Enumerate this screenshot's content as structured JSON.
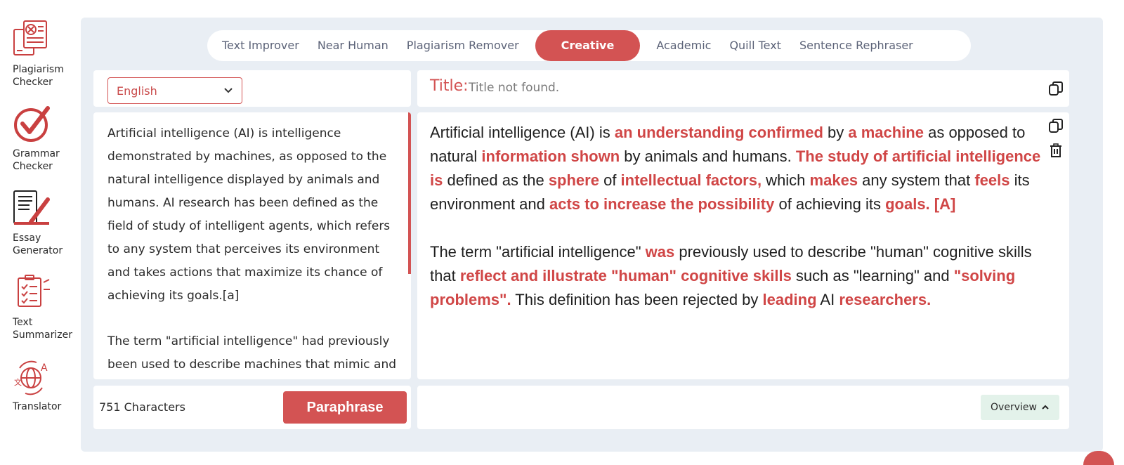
{
  "sidebar": {
    "items": [
      {
        "label_line1": "Plagiarism",
        "label_line2": "Checker",
        "icon": "plagiarism-icon"
      },
      {
        "label_line1": "Grammar",
        "label_line2": "Checker",
        "icon": "grammar-check-icon"
      },
      {
        "label_line1": "Essay",
        "label_line2": "Generator",
        "icon": "essay-icon"
      },
      {
        "label_line1": "Text",
        "label_line2": "Summarizer",
        "icon": "summarizer-icon"
      },
      {
        "label_line1": "Translator",
        "label_line2": "",
        "icon": "translator-icon"
      }
    ]
  },
  "tabs": [
    {
      "label": "Text Improver"
    },
    {
      "label": "Near Human"
    },
    {
      "label": "Plagiarism Remover"
    },
    {
      "label": "Creative",
      "active": true
    },
    {
      "label": "Academic"
    },
    {
      "label": "Quill Text"
    },
    {
      "label": "Sentence Rephraser"
    }
  ],
  "language": {
    "selected": "English"
  },
  "input": {
    "paragraph1": "Artificial intelligence (AI) is intelligence demonstrated by machines, as opposed to the natural intelligence displayed by animals and humans. AI research has been defined as the field of study of intelligent agents, which refers to any system that perceives its environment and takes actions that maximize its chance of achieving its goals.[a]",
    "paragraph2": "The term \"artificial intelligence\" had previously been used to describe machines that mimic and display \"human\" cognitive skills"
  },
  "output": {
    "title_label": "Title:",
    "title_value": "Title not found.",
    "p1": [
      {
        "t": "Artificial intelligence (AI) is ",
        "h": false
      },
      {
        "t": "an understanding confirmed",
        "h": true
      },
      {
        "t": " by ",
        "h": false
      },
      {
        "t": "a machine",
        "h": true
      },
      {
        "t": " as opposed to natural ",
        "h": false
      },
      {
        "t": "information shown",
        "h": true
      },
      {
        "t": " by animals and humans. ",
        "h": false
      },
      {
        "t": "The study of artificial intelligence is",
        "h": true
      },
      {
        "t": " defined as the ",
        "h": false
      },
      {
        "t": "sphere",
        "h": true
      },
      {
        "t": " of ",
        "h": false
      },
      {
        "t": "intellectual factors,",
        "h": true
      },
      {
        "t": " which ",
        "h": false
      },
      {
        "t": "makes",
        "h": true
      },
      {
        "t": " any system that ",
        "h": false
      },
      {
        "t": "feels",
        "h": true
      },
      {
        "t": " its environment and ",
        "h": false
      },
      {
        "t": "acts to increase the possibility",
        "h": true
      },
      {
        "t": " of achieving its ",
        "h": false
      },
      {
        "t": "goals. [A]",
        "h": true
      }
    ],
    "p2": [
      {
        "t": "The term \"artificial intelligence\" ",
        "h": false
      },
      {
        "t": "was",
        "h": true
      },
      {
        "t": " previously used to describe \"human\" cognitive skills that ",
        "h": false
      },
      {
        "t": "reflect and illustrate \"human\" cognitive skills",
        "h": true
      },
      {
        "t": " such as \"learning\" and ",
        "h": false
      },
      {
        "t": "\"solving problems\".",
        "h": true
      },
      {
        "t": " This definition has been rejected by ",
        "h": false
      },
      {
        "t": "leading",
        "h": true
      },
      {
        "t": " AI ",
        "h": false
      },
      {
        "t": "researchers.",
        "h": true
      }
    ]
  },
  "footer": {
    "char_count": "751 Characters",
    "paraphrase_label": "Paraphrase",
    "overview_label": "Overview"
  },
  "colors": {
    "accent": "#d35353",
    "panel_bg": "#e9eef4",
    "overview_bg": "#e3f2ea"
  }
}
